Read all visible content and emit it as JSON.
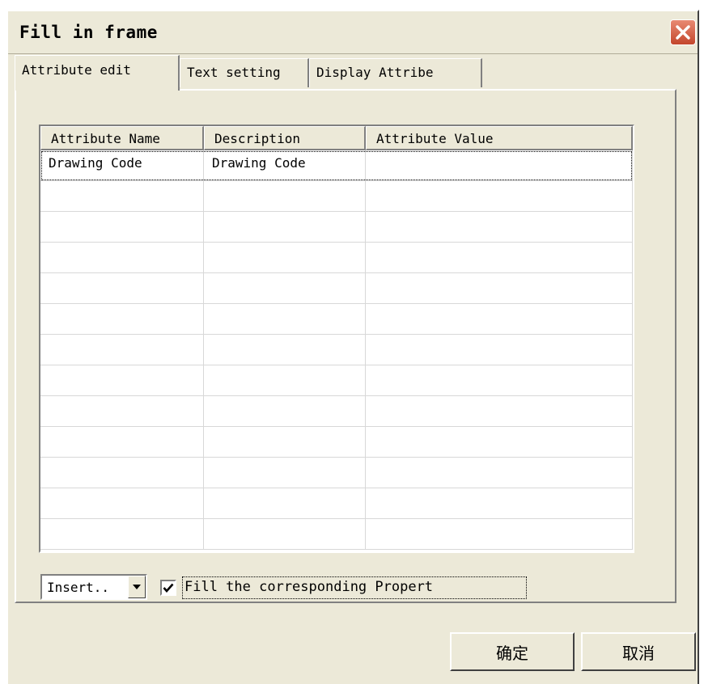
{
  "window": {
    "title": "Fill in frame"
  },
  "tabs": [
    {
      "label": "Attribute edit",
      "active": true
    },
    {
      "label": "Text setting",
      "active": false
    },
    {
      "label": "Display Attribe",
      "active": false
    }
  ],
  "grid": {
    "columns": [
      "Attribute Name",
      "Description",
      "Attribute Value"
    ],
    "rows": [
      [
        "Drawing Code",
        "Drawing Code",
        ""
      ]
    ],
    "empty_rows": 12
  },
  "footer": {
    "insert_combo_value": "Insert..",
    "fill_checkbox_checked": true,
    "fill_checkbox_label": "Fill the corresponding Propert",
    "ok_label": "确定",
    "cancel_label": "取消"
  },
  "icons": {
    "close": "close-icon",
    "dropdown": "dropdown-arrow-icon",
    "check": "checkmark-icon"
  },
  "colors": {
    "dialog_bg": "#ece9d8",
    "close_button": "#c3462c"
  }
}
